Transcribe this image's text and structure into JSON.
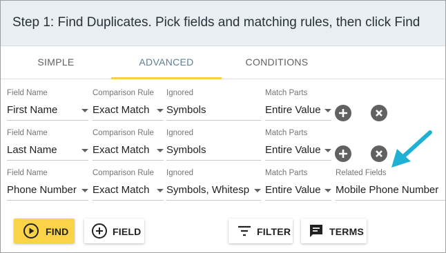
{
  "header": {
    "title": "Step 1: Find Duplicates. Pick fields and matching rules, then click Find"
  },
  "tabs": [
    {
      "label": "SIMPLE"
    },
    {
      "label": "ADVANCED"
    },
    {
      "label": "CONDITIONS"
    }
  ],
  "active_tab": "ADVANCED",
  "labels": {
    "field_name": "Field Name",
    "comparison_rule": "Comparison Rule",
    "ignored": "Ignored",
    "match_parts": "Match Parts",
    "related_fields": "Related Fields"
  },
  "rows": [
    {
      "field": "First Name",
      "rule": "Exact Match",
      "ignored": "Symbols",
      "match_parts": "Entire Value"
    },
    {
      "field": "Last Name",
      "rule": "Exact Match",
      "ignored": "Symbols",
      "match_parts": "Entire Value"
    },
    {
      "field": "Phone Number",
      "rule": "Exact Match",
      "ignored": "Symbols, Whitesp",
      "match_parts": "Entire Value",
      "related_fields": "Mobile Phone Number"
    }
  ],
  "buttons": {
    "find": "FIND",
    "field": "FIELD",
    "filter": "FILTER",
    "terms": "TERMS"
  },
  "colors": {
    "accent_yellow": "#fbd346",
    "tab_indicator": "#f6d04d",
    "active_tab_text": "#5c7f93",
    "header_bg": "#e9eef2",
    "arrow": "#1eb1d4"
  },
  "icons": {
    "find": "play-circle-icon",
    "field": "add-circle-icon",
    "filter": "filter-icon",
    "terms": "comment-icon",
    "add": "plus-circle-icon",
    "remove": "close-circle-icon",
    "callout": "arrow-icon"
  }
}
